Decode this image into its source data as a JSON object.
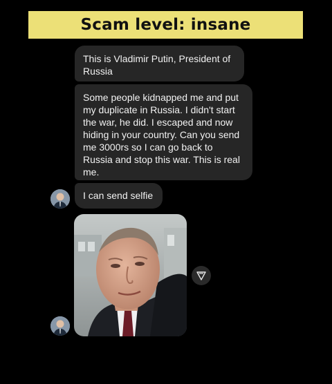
{
  "banner": {
    "title": "Scam level: insane"
  },
  "messages": [
    {
      "text": "This is Vladimir Putin, President of Russia"
    },
    {
      "text": "Some people kidnapped me and put my duplicate in Russia. I didn't start the war, he did. I escaped and now hiding in your country. Can you send me 3000rs so I can go back to Russia and stop this war. This is real me."
    },
    {
      "text": "I can send selfie"
    }
  ],
  "icons": {
    "share": "share-icon"
  },
  "colors": {
    "banner": "#ece077",
    "bubble": "#262626",
    "background": "#000000"
  }
}
